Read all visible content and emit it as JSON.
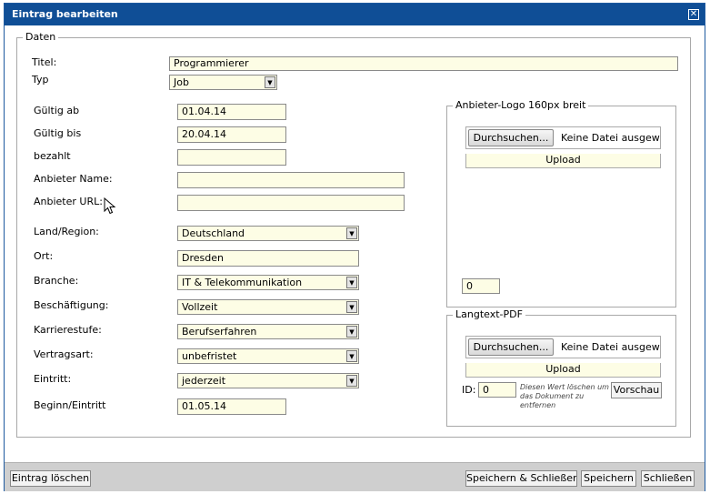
{
  "dialog": {
    "title": "Eintrag bearbeiten"
  },
  "daten": {
    "legend": "Daten",
    "titel_label": "Titel:",
    "titel_value": "Programmierer",
    "typ_label": "Typ",
    "typ_value": "Job"
  },
  "form": {
    "gueltig_ab_label": "Gültig ab",
    "gueltig_ab_value": "01.04.14",
    "gueltig_bis_label": "Gültig bis",
    "gueltig_bis_value": "20.04.14",
    "bezahlt_label": "bezahlt",
    "bezahlt_value": "",
    "anbieter_name_label": "Anbieter Name:",
    "anbieter_name_value": "",
    "anbieter_url_label": "Anbieter URL:",
    "anbieter_url_value": "",
    "land_label": "Land/Region:",
    "land_value": "Deutschland",
    "ort_label": "Ort:",
    "ort_value": "Dresden",
    "branche_label": "Branche:",
    "branche_value": "IT & Telekommunikation",
    "beschaeftigung_label": "Beschäftigung:",
    "beschaeftigung_value": "Vollzeit",
    "karrierestufe_label": "Karrierestufe:",
    "karrierestufe_value": "Berufserfahren",
    "vertragsart_label": "Vertragsart:",
    "vertragsart_value": "unbefristet",
    "eintritt_label": "Eintritt:",
    "eintritt_value": "jederzeit",
    "beginn_label": "Beginn/Eintritt",
    "beginn_value": "01.05.14"
  },
  "logo": {
    "legend": "Anbieter-Logo 160px breit",
    "browse_label": "Durchsuchen...",
    "no_file": "Keine Datei ausgewählt.",
    "upload_label": "Upload",
    "id_value": "0"
  },
  "pdf": {
    "legend": "Langtext-PDF",
    "browse_label": "Durchsuchen...",
    "no_file": "Keine Datei ausgewählt.",
    "upload_label": "Upload",
    "id_label": "ID:",
    "id_value": "0",
    "note": "Diesen Wert löschen um das Dokument zu entfernen",
    "preview_label": "Vorschau"
  },
  "footer": {
    "delete_label": "Eintrag löschen",
    "save_close_label": "Speichern & Schließen",
    "save_label": "Speichern",
    "close_label": "Schließen"
  },
  "icons": {
    "close": "close-icon",
    "dropdown": "chevron-down-icon",
    "cursor": "mouse-pointer-icon"
  }
}
